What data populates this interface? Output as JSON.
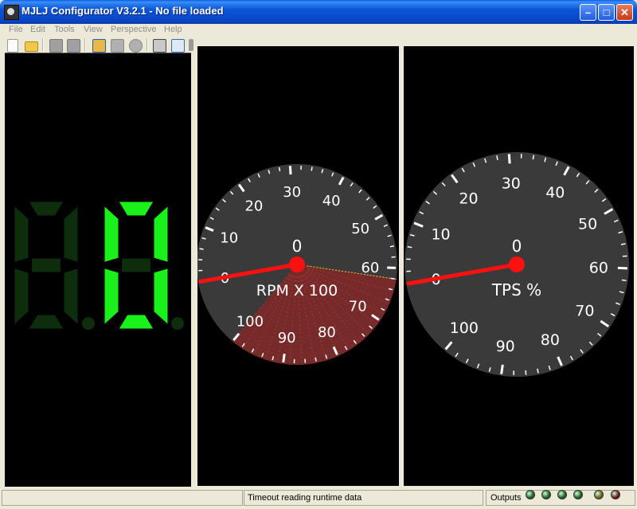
{
  "window": {
    "title": "MJLJ Configurator V3.2.1 - No file loaded"
  },
  "menu": [
    {
      "label": "File"
    },
    {
      "label": "Edit"
    },
    {
      "label": "Tools"
    },
    {
      "label": "View"
    },
    {
      "label": "Perspective"
    },
    {
      "label": "Help"
    }
  ],
  "toolbar": {
    "icons": [
      "new-file-icon",
      "open-folder-icon",
      "save-icon",
      "save-as-icon",
      "upload-icon",
      "download-icon",
      "burn-icon",
      "settings-icon",
      "chart-icon",
      "tool-icon"
    ]
  },
  "gear_display": {
    "digits": [
      "8",
      "0"
    ],
    "active_value": "0",
    "segment_on_color": "#1af01a",
    "segment_off_color": "#0d2d0d"
  },
  "rpm_gauge": {
    "label": "RPM X 100",
    "value_text": "0",
    "value": 0,
    "ticks": [
      "0",
      "10",
      "20",
      "30",
      "40",
      "50",
      "60",
      "70",
      "80",
      "90",
      "100"
    ],
    "redline_start": 62,
    "needle_color": "#ff1010"
  },
  "tps_gauge": {
    "label": "TPS %",
    "value_text": "0",
    "value": 0,
    "ticks": [
      "0",
      "10",
      "20",
      "30",
      "40",
      "50",
      "60",
      "70",
      "80",
      "90",
      "100"
    ],
    "needle_color": "#ff1010"
  },
  "statusbar": {
    "message": "Timeout reading runtime data",
    "outputs_label": "Outputs",
    "leds": [
      "#1a5a1a",
      "#1a5a1a",
      "#1a5a1a",
      "#1a5a1a",
      "#6b5a10",
      "#6b1010"
    ]
  }
}
